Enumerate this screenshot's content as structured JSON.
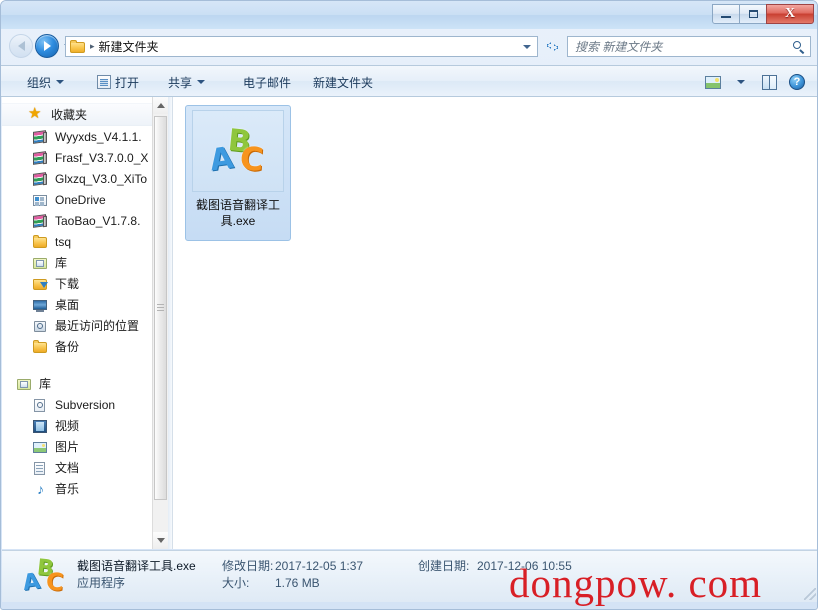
{
  "window": {
    "controls": {
      "minimize": "–",
      "maximize": "□",
      "close": "X"
    }
  },
  "address": {
    "breadcrumb_separator": "▸",
    "path": "新建文件夹",
    "refresh_glyph": "↺",
    "dropdown_glyph": "▼"
  },
  "search": {
    "placeholder": "搜索 新建文件夹",
    "icon": "search-icon"
  },
  "toolbar": {
    "organize": "组织",
    "open": "打开",
    "share": "共享",
    "email": "电子邮件",
    "new_folder": "新建文件夹",
    "help_glyph": "?"
  },
  "sidebar": {
    "favorites_header": "收藏夹",
    "items": [
      {
        "label": "Wyyxds_V4.1.1.",
        "icon": "books-icon"
      },
      {
        "label": "Frasf_V3.7.0.0_X",
        "icon": "books-icon"
      },
      {
        "label": "Glxzq_V3.0_XiTo",
        "icon": "books-icon"
      },
      {
        "label": "OneDrive",
        "icon": "onedrive-icon"
      },
      {
        "label": "TaoBao_V1.7.8.",
        "icon": "books-icon"
      },
      {
        "label": "tsq",
        "icon": "folder-icon"
      },
      {
        "label": "库",
        "icon": "library-icon"
      },
      {
        "label": "下载",
        "icon": "download-icon"
      },
      {
        "label": "桌面",
        "icon": "desktop-icon"
      },
      {
        "label": "最近访问的位置",
        "icon": "recent-places-icon"
      },
      {
        "label": "备份",
        "icon": "folder-icon"
      }
    ],
    "library_header": "库",
    "library_items": [
      {
        "label": "Subversion",
        "icon": "subversion-icon"
      },
      {
        "label": "视频",
        "icon": "video-icon"
      },
      {
        "label": "图片",
        "icon": "picture-icon"
      },
      {
        "label": "文档",
        "icon": "document-icon"
      },
      {
        "label": "音乐",
        "icon": "music-icon"
      }
    ]
  },
  "content": {
    "files": [
      {
        "name": "截图语音翻译工具.exe",
        "icon": "abc-app-icon",
        "selected": true
      }
    ]
  },
  "statusbar": {
    "file_name": "截图语音翻译工具.exe",
    "file_type": "应用程序",
    "modified_label": "修改日期:",
    "modified_value": "2017-12-05 1:37",
    "size_label": "大小:",
    "size_value": "1.76 MB",
    "created_label": "创建日期:",
    "created_value": "2017-12-06 10:55"
  },
  "watermark": {
    "text": "dongpow. com",
    "color": "#d81f26"
  },
  "colors": {
    "selection": "#c6dcf4",
    "selection_border": "#9cc2e6",
    "frame": "#a5bdd8",
    "close_button": "#c93f31",
    "accent_blue": "#2f8de0"
  }
}
